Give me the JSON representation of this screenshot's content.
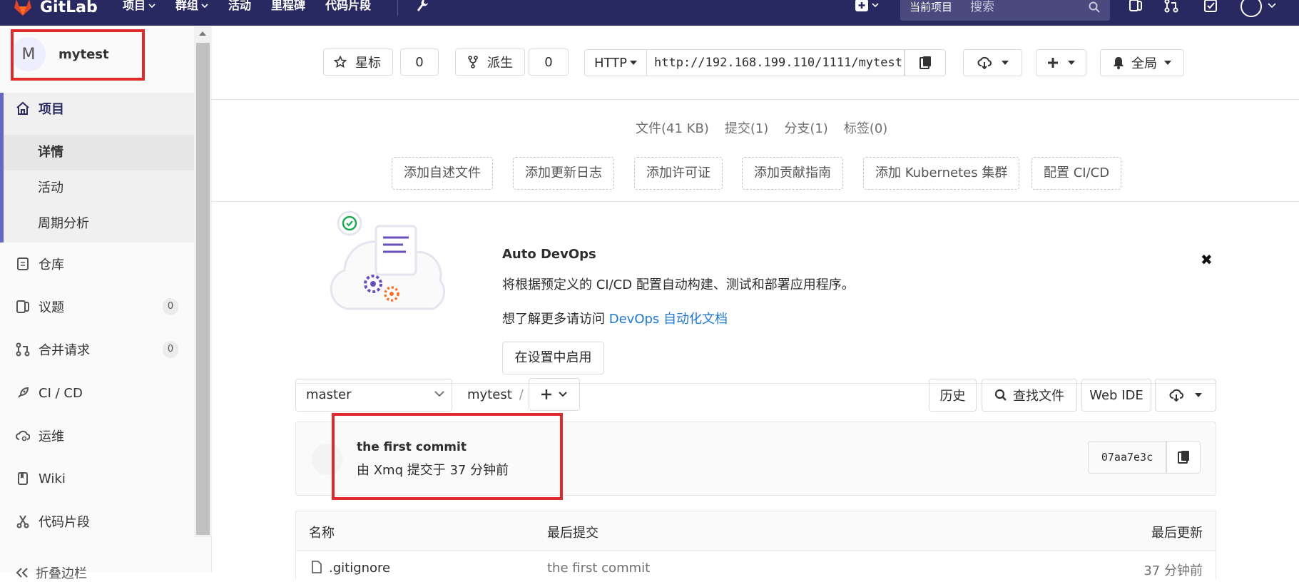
{
  "app": {
    "name": "GitLab"
  },
  "topnav": {
    "items": [
      {
        "label": "项目",
        "dropdown": true
      },
      {
        "label": "群组",
        "dropdown": true
      },
      {
        "label": "活动",
        "dropdown": false
      },
      {
        "label": "里程碑",
        "dropdown": false
      },
      {
        "label": "代码片段",
        "dropdown": false
      }
    ],
    "scope_label": "当前项目",
    "search_placeholder": "搜索"
  },
  "sidebar": {
    "project_initial": "M",
    "project_name": "mytest",
    "items": [
      {
        "label": "项目",
        "icon": "home-icon"
      },
      {
        "label": "仓库",
        "icon": "doc-icon"
      },
      {
        "label": "议题",
        "icon": "issues-icon",
        "badge": "0"
      },
      {
        "label": "合并请求",
        "icon": "merge-request-icon",
        "badge": "0"
      },
      {
        "label": "CI / CD",
        "icon": "rocket-icon"
      },
      {
        "label": "运维",
        "icon": "cloud-gear-icon"
      },
      {
        "label": "Wiki",
        "icon": "book-icon"
      },
      {
        "label": "代码片段",
        "icon": "scissors-icon"
      }
    ],
    "subitems": [
      {
        "label": "详情",
        "current": true
      },
      {
        "label": "活动",
        "current": false
      },
      {
        "label": "周期分析",
        "current": false
      }
    ],
    "collapse_label": "折叠边栏"
  },
  "project_header": {
    "star_label": "星标",
    "star_count": "0",
    "fork_label": "派生",
    "fork_count": "0",
    "protocol": "HTTP",
    "clone_url": "http://192.168.199.110/1111/mytest.git",
    "notification_label": "全局"
  },
  "stats": [
    "文件(41 KB)",
    "提交(1)",
    "分支(1)",
    "标签(0)"
  ],
  "quick_actions": [
    "添加自述文件",
    "添加更新日志",
    "添加许可证",
    "添加贡献指南",
    "添加 Kubernetes 集群",
    "配置 CI/CD"
  ],
  "devops": {
    "title": "Auto DevOps",
    "description": "将根据预定义的 CI/CD 配置自动构建、测试和部署应用程序。",
    "learn_prefix": "想了解更多请访问",
    "learn_link": "DevOps 自动化文档",
    "enable_button": "在设置中启用"
  },
  "repo": {
    "branch": "master",
    "path_root": "mytest",
    "path_sep": "/",
    "history_label": "历史",
    "find_file_label": "查找文件",
    "web_ide_label": "Web IDE"
  },
  "last_commit": {
    "title": "the first commit",
    "meta": "由 Xmq 提交于 37 分钟前",
    "sha": "07aa7e3c"
  },
  "file_table": {
    "headers": [
      "名称",
      "最后提交",
      "最后更新"
    ],
    "rows": [
      {
        "name": ".gitignore",
        "commit": "the first commit",
        "updated": "37 分钟前"
      }
    ]
  }
}
